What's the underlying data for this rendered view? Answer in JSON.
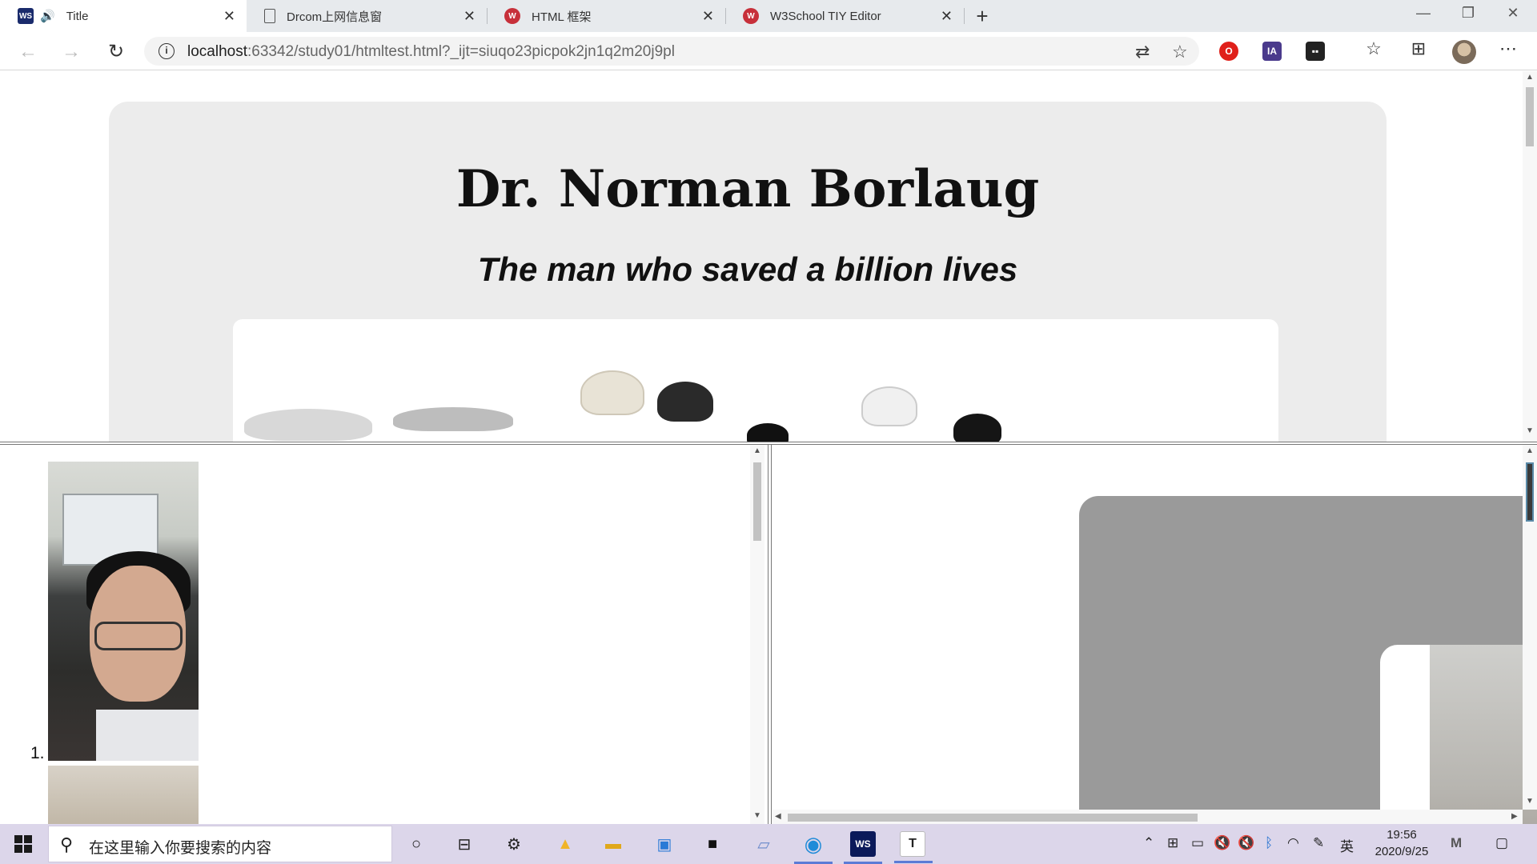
{
  "tabs": [
    {
      "title": "Title",
      "active": true,
      "favicon": "webstorm-icon"
    },
    {
      "title": "Drcom上网信息窗",
      "active": false,
      "favicon": "page-icon"
    },
    {
      "title": "HTML 框架",
      "active": false,
      "favicon": "w3school-icon"
    },
    {
      "title": "W3School TIY Editor",
      "active": false,
      "favicon": "w3school-icon"
    }
  ],
  "address": {
    "host": "localhost",
    "rest": ":63342/study01/htmltest.html?_ijt=siuqo23picpok2jn1q2m20j9pl"
  },
  "top_frame": {
    "heading": "Dr. Norman Borlaug",
    "subheading": "The man who saved a billion lives"
  },
  "left_frame": {
    "list_marker": "1."
  },
  "taskbar": {
    "search_placeholder": "在这里输入你要搜索的内容",
    "ime": "英",
    "time": "19:56",
    "date": "2020/9/25"
  },
  "colors": {
    "tabbar": "#e7eaed",
    "taskbar": "#dcd6ea",
    "card": "#ececec",
    "gray_card": "#9a9a9a"
  }
}
